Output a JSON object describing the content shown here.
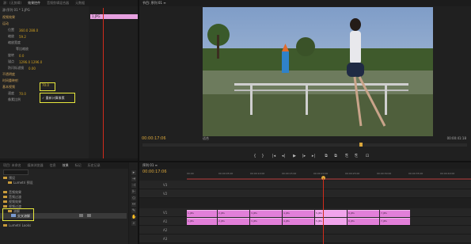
{
  "effect_controls": {
    "tabs": [
      "源：(无剪辑)",
      "效果控件",
      "音频剪辑混合器",
      "元数据"
    ],
    "clip_label": "源·序列 01 * 1.JPG",
    "clip_chip": "1.JPG",
    "sections": [
      {
        "label": "视频效果"
      },
      {
        "label": "运动",
        "value": ""
      },
      {
        "label": "位置",
        "value": "360.0   288.0"
      },
      {
        "label": "缩放",
        "value": "59.2"
      },
      {
        "label": "缩放宽度",
        "value": ""
      },
      {
        "label": "等比缩放",
        "value": ""
      },
      {
        "label": "旋转",
        "value": "0.0"
      },
      {
        "label": "锚点",
        "value": "1296.0  1296.0"
      },
      {
        "label": "防闪烁滤镜",
        "value": "0.00"
      },
      {
        "label": "不透明度",
        "value": ""
      },
      {
        "label": "时间重映射",
        "value": ""
      },
      {
        "label": "基本视频",
        "value": ""
      },
      {
        "label": "速度",
        "value": "70.0"
      },
      {
        "label": "像素比例",
        "value": ""
      },
      {
        "label": "重新计算像素",
        "value": ""
      }
    ],
    "highlight_value": "70.0",
    "highlight_check": "✓ 重新计算像素"
  },
  "program": {
    "tab": "节目: 序列 01 ≡",
    "timecode_left": "00:00:17:06",
    "timecode_right": "00:00:41:18",
    "fit": "适合",
    "controls": [
      "⊢",
      "{",
      "}",
      "|◂",
      "◂|",
      "▶",
      "|▸",
      "▸|",
      "⧉",
      "⧉",
      "⎘",
      "⎘",
      "⊡"
    ]
  },
  "project": {
    "tabs": [
      "项目: 未命名",
      "媒体浏览器",
      "信息",
      "效果",
      "标记",
      "历史记录"
    ],
    "search_placeholder": "",
    "items": [
      {
        "label": "预设",
        "indent": 0
      },
      {
        "label": "Lumetri 预设",
        "indent": 1
      },
      {
        "label": "音频效果",
        "indent": 0
      },
      {
        "label": "音频过渡",
        "indent": 0
      },
      {
        "label": "视频效果",
        "indent": 0
      },
      {
        "label": "视频过渡",
        "indent": 0
      },
      {
        "label": "溶解",
        "indent": 1
      },
      {
        "label": "交叉溶解",
        "indent": 2
      },
      {
        "label": "Lumetri Looks",
        "indent": 0
      }
    ],
    "selected_item": "交叉溶解"
  },
  "timeline": {
    "tab": "序列 01 ≡",
    "timecode": "00:00:17:06",
    "ruler_labels": [
      "00:00",
      "00:00:05:00",
      "00:00:10:00",
      "00:00:15:00",
      "00:00:20:00",
      "00:00:25:00",
      "00:00:30:00",
      "00:00:35:00",
      "00:00:40:00"
    ],
    "tracks": [
      {
        "label": "V3"
      },
      {
        "label": "V2"
      },
      {
        "label": "V1"
      },
      {
        "label": "A1"
      },
      {
        "label": "A2"
      },
      {
        "label": "A3"
      }
    ],
    "clips_v1": [
      "1.JPG",
      "2.JPG",
      "3.JPG",
      "4.JPG",
      "5.JPG",
      "6.JPG",
      "7.JPG"
    ],
    "clips_v1b": [
      "1.JPG",
      "2.JPG",
      "3.JPG",
      "4.JPG",
      "5.JPG",
      "6.JPG",
      "7.JPG"
    ]
  },
  "colors": {
    "accent_pink": "#e27fd9",
    "playhead": "#d12c1c",
    "highlight": "#e8e83c",
    "value_orange": "#d0a020"
  }
}
